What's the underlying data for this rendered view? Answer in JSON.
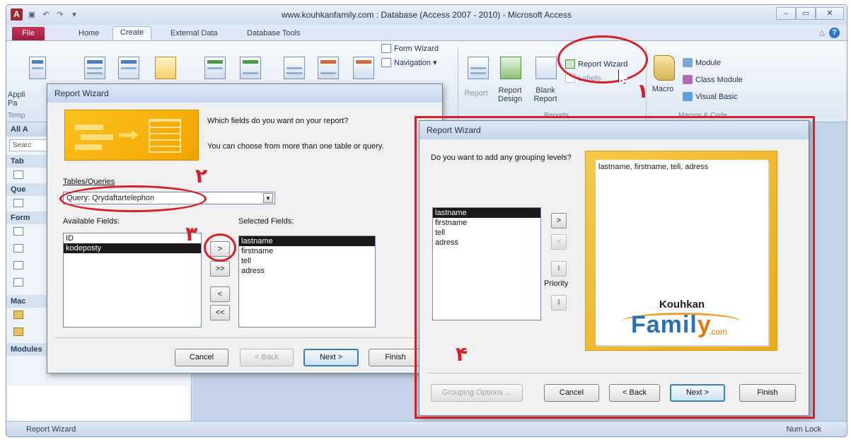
{
  "window": {
    "title": "www.kouhkanfamily.com : Database (Access 2007 - 2010)  -  Microsoft Access",
    "app_letter": "A",
    "controls": [
      "–",
      "▭",
      "✕"
    ]
  },
  "ribbon": {
    "file_tab": "File",
    "tabs": [
      "Home",
      "Create",
      "External Data",
      "Database Tools"
    ],
    "active_tab": "Create",
    "app_parts_label": "Appli Pa",
    "templates_group": "Temp",
    "forms": {
      "form_wizard": "Form Wizard",
      "navigation": "Navigation ▾"
    },
    "reports": {
      "report": "Report",
      "report_design": "Report Design",
      "blank_report": "Blank Report",
      "report_wizard": "Report Wizard",
      "labels": "Labels",
      "group": "Reports"
    },
    "macros": {
      "macro": "Macro",
      "module": "Module",
      "class_module": "Class Module",
      "visual_basic": "Visual Basic",
      "group": "Macros & Code"
    }
  },
  "nav": {
    "header": "All A",
    "search": "Searc",
    "sections": [
      "Tab",
      "Que",
      "Form",
      "Mac",
      "Modules"
    ]
  },
  "status": {
    "left": "Report Wizard",
    "right": "Num Lock"
  },
  "wizard1": {
    "title": "Report Wizard",
    "question": "Which fields do you want on your report?",
    "hint": "You can choose from more than one table or query.",
    "tables_label": "Tables/Queries",
    "selected_query": "Query: Qrydaftartelephon",
    "available_label": "Available Fields:",
    "selected_label": "Selected Fields:",
    "available_fields": [
      "ID",
      "kodeposty"
    ],
    "selected_fields": [
      "lastname",
      "firstname",
      "tell",
      "adress"
    ],
    "buttons": {
      "add": ">",
      "add_all": ">>",
      "remove": "<",
      "remove_all": "<<",
      "cancel": "Cancel",
      "back": "< Back",
      "next": "Next >",
      "finish": "Finish"
    }
  },
  "wizard2": {
    "title": "Report Wizard",
    "question": "Do you want to add any grouping levels?",
    "fields": [
      "lastname",
      "firstname",
      "tell",
      "adress"
    ],
    "preview_text": "lastname, firstname, tell, adress",
    "priority_label": "Priority",
    "logo": {
      "top": "Kouhkan",
      "main_a": "Famil",
      "main_b": "y",
      "suffix": ".com"
    },
    "buttons": {
      "add": ">",
      "remove": "<",
      "up": "⬆",
      "down": "⬇",
      "grouping_options": "Grouping Options ...",
      "cancel": "Cancel",
      "back": "< Back",
      "next": "Next >",
      "finish": "Finish"
    }
  },
  "annotations": {
    "step1": "۱",
    "step2": "۲",
    "step3": "۳",
    "step4": "۴",
    "color": "#d4202a"
  }
}
